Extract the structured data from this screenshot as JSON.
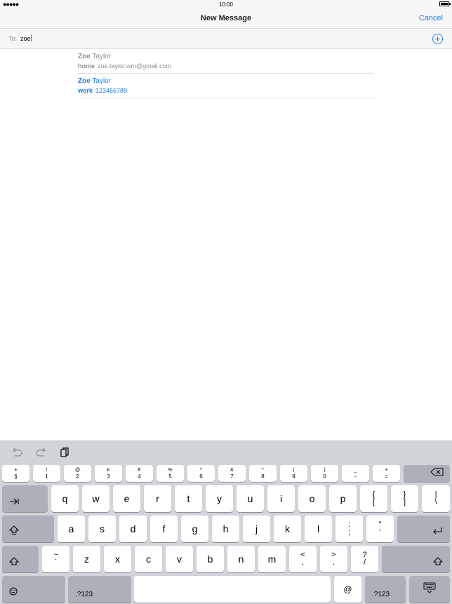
{
  "status": {
    "time": "10:00",
    "signal": "●●●●●"
  },
  "nav": {
    "title": "New Message",
    "cancel": "Cancel"
  },
  "to": {
    "label": "To:",
    "value": "zoe"
  },
  "suggestions": [
    {
      "match": "Zoe",
      "rest": " Taylor",
      "kind": "home",
      "detail": "zoe.taylor.wm@gmail.com"
    },
    {
      "match": "Zoe",
      "rest": " Taylor",
      "kind": "work",
      "detail": "123456789"
    }
  ],
  "keyboard": {
    "number_row": [
      {
        "top": "±",
        "bottom": "§"
      },
      {
        "top": "!",
        "bottom": "1"
      },
      {
        "top": "@",
        "bottom": "2"
      },
      {
        "top": "£",
        "bottom": "3"
      },
      {
        "top": "€",
        "bottom": "4"
      },
      {
        "top": "%",
        "bottom": "5"
      },
      {
        "top": "^",
        "bottom": "6"
      },
      {
        "top": "&",
        "bottom": "7"
      },
      {
        "top": "*",
        "bottom": "8"
      },
      {
        "top": "(",
        "bottom": "9"
      },
      {
        "top": ")",
        "bottom": "0"
      },
      {
        "top": "_",
        "bottom": "-"
      },
      {
        "top": "+",
        "bottom": "="
      }
    ],
    "row1": [
      "q",
      "w",
      "e",
      "r",
      "t",
      "y",
      "u",
      "i",
      "o",
      "p"
    ],
    "row1_extra": [
      {
        "top": "{",
        "bottom": "["
      },
      {
        "top": "}",
        "bottom": "]"
      },
      {
        "top": "|",
        "bottom": "\\"
      }
    ],
    "row2": [
      "a",
      "s",
      "d",
      "f",
      "g",
      "h",
      "j",
      "k",
      "l"
    ],
    "row2_extra": [
      {
        "top": ":",
        "bottom": ";"
      },
      {
        "top": "\"",
        "bottom": "'"
      }
    ],
    "row3_extra_left": {
      "top": "~",
      "bottom": "`"
    },
    "row3": [
      "z",
      "x",
      "c",
      "v",
      "b",
      "n",
      "m"
    ],
    "row3_extra": [
      {
        "top": "<",
        "bottom": ","
      },
      {
        "top": ">",
        "bottom": "."
      },
      {
        "top": "?",
        "bottom": "/"
      }
    ],
    "at": "@",
    "numbers_label": ".?123"
  }
}
